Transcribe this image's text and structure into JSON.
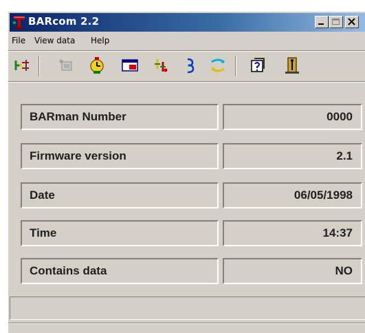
{
  "window": {
    "title": "BARcom 2.2"
  },
  "menu": {
    "file": "File",
    "view_data": "View data",
    "help": "Help"
  },
  "toolbar": {
    "icons": [
      "connect-icon",
      "add-icon",
      "timer-icon",
      "monitor-icon",
      "transfer-icon",
      "download-icon",
      "sync-icon",
      "about-icon",
      "exit-icon"
    ]
  },
  "fields": [
    {
      "label": "BARman Number",
      "value": "0000"
    },
    {
      "label": "Firmware version",
      "value": "2.1"
    },
    {
      "label": "Date",
      "value": "06/05/1998"
    },
    {
      "label": "Time",
      "value": "14:37"
    },
    {
      "label": "Contains data",
      "value": "NO"
    }
  ],
  "status": {
    "text": ""
  },
  "colors": {
    "title_gradient_start": "#0a246a",
    "title_gradient_end": "#a6caf0",
    "face": "#d4d0c8"
  }
}
